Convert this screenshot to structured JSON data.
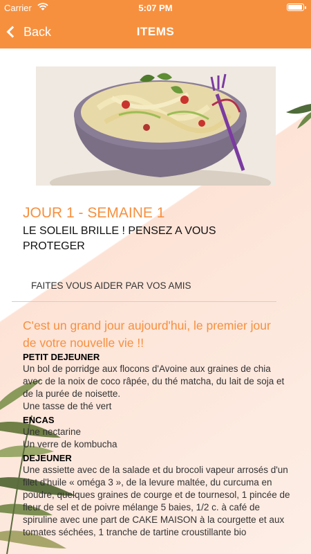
{
  "status_bar": {
    "carrier": "Carrier",
    "time": "5:07 PM"
  },
  "nav": {
    "back_label": "Back",
    "title": "ITEMS"
  },
  "item": {
    "day_title": "JOUR 1 - SEMAINE 1",
    "subtitle": "LE SOLEIL BRILLE ! PENSEZ A VOUS PROTEGER",
    "help_text": "FAITES VOUS AIDER PAR VOS AMIS",
    "intro": "C'est un grand jour aujourd'hui, le premier jour de votre nouvelle vie !!"
  },
  "meals": [
    {
      "title": "PETIT DEJEUNER",
      "lines": [
        "Un bol de  porridge aux flocons d'Avoine  aux graines de chia avec de la noix de coco râpée, du thé matcha, du lait de soja et de la purée de noisette.",
        "Une tasse de thé vert"
      ]
    },
    {
      "title": "ENCAS",
      "lines": [
        "Une nectarine",
        "Un verre de kombucha"
      ]
    },
    {
      "title": "DEJEUNER",
      "lines": [
        "Une assiette avec de la salade et du brocoli vapeur arrosés d'un filet d'huile « oméga 3 », de la levure maltée, du curcuma en poudre, quelques graines de courge et de tournesol, 1 pincée de fleur de sel et de poivre mélange 5 baies, 1/2 c. à café de spiruline avec une part de CAKE MAISON à la courgette et aux tomates séchées, 1 tranche de tartine croustillante bio"
      ]
    }
  ],
  "colors": {
    "accent": "#f6903f",
    "peach_bg": "#fde3d6"
  },
  "icons": {
    "back": "chevron-left-icon",
    "wifi": "wifi-icon",
    "battery": "battery-icon"
  }
}
